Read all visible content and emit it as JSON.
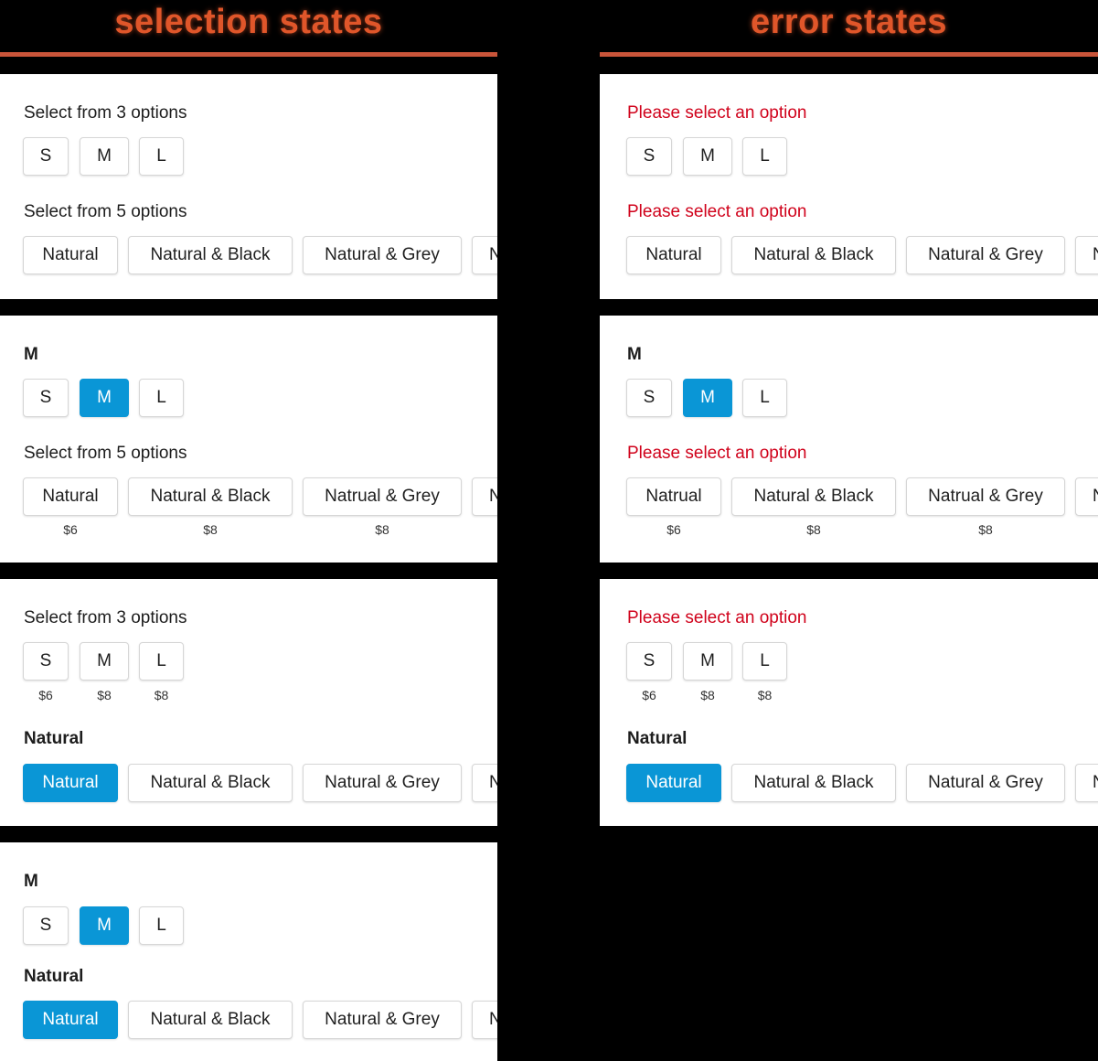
{
  "headers": {
    "left": "selection states",
    "right": "error states"
  },
  "colors": {
    "accent": "#0a96d6",
    "error": "#d0021b",
    "heading": "#e0562a"
  },
  "panels": {
    "sel1": {
      "size_label": "Select from 3 options",
      "sizes": [
        "S",
        "M",
        "L"
      ],
      "color_label": "Select from 5 options",
      "colors": [
        "Natural",
        "Natural & Black",
        "Natural & Grey",
        "N"
      ]
    },
    "sel2": {
      "size_label": "M",
      "sizes": [
        "S",
        "M",
        "L"
      ],
      "selected_size": "M",
      "color_label": "Select from 5 options",
      "colors": [
        "Natural",
        "Natural & Black",
        "Natrual & Grey",
        "N"
      ],
      "color_prices": [
        "$6",
        "$8",
        "$8"
      ]
    },
    "sel3": {
      "size_label": "Select from 3 options",
      "sizes": [
        "S",
        "M",
        "L"
      ],
      "size_prices": [
        "$6",
        "$8",
        "$8"
      ],
      "color_label": "Natural",
      "colors": [
        "Natural",
        "Natural & Black",
        "Natural & Grey",
        "N"
      ],
      "selected_color": "Natural"
    },
    "sel4": {
      "size_label": "M",
      "sizes": [
        "S",
        "M",
        "L"
      ],
      "selected_size": "M",
      "color_label": "Natural",
      "colors": [
        "Natural",
        "Natural & Black",
        "Natural & Grey",
        "N"
      ],
      "selected_color": "Natural"
    },
    "err1": {
      "size_label": "Please select an option",
      "sizes": [
        "S",
        "M",
        "L"
      ],
      "color_label": "Please select an option",
      "colors": [
        "Natural",
        "Natural & Black",
        "Natural & Grey",
        "N"
      ]
    },
    "err2": {
      "size_label": "M",
      "sizes": [
        "S",
        "M",
        "L"
      ],
      "selected_size": "M",
      "color_label": "Please select an option",
      "colors": [
        "Natrual",
        "Natural & Black",
        "Natrual & Grey",
        "N"
      ],
      "color_prices": [
        "$6",
        "$8",
        "$8"
      ]
    },
    "err3": {
      "size_label": "Please select an option",
      "sizes": [
        "S",
        "M",
        "L"
      ],
      "size_prices": [
        "$6",
        "$8",
        "$8"
      ],
      "color_label": "Natural",
      "colors": [
        "Natural",
        "Natural & Black",
        "Natural & Grey",
        "N"
      ],
      "selected_color": "Natural"
    }
  }
}
